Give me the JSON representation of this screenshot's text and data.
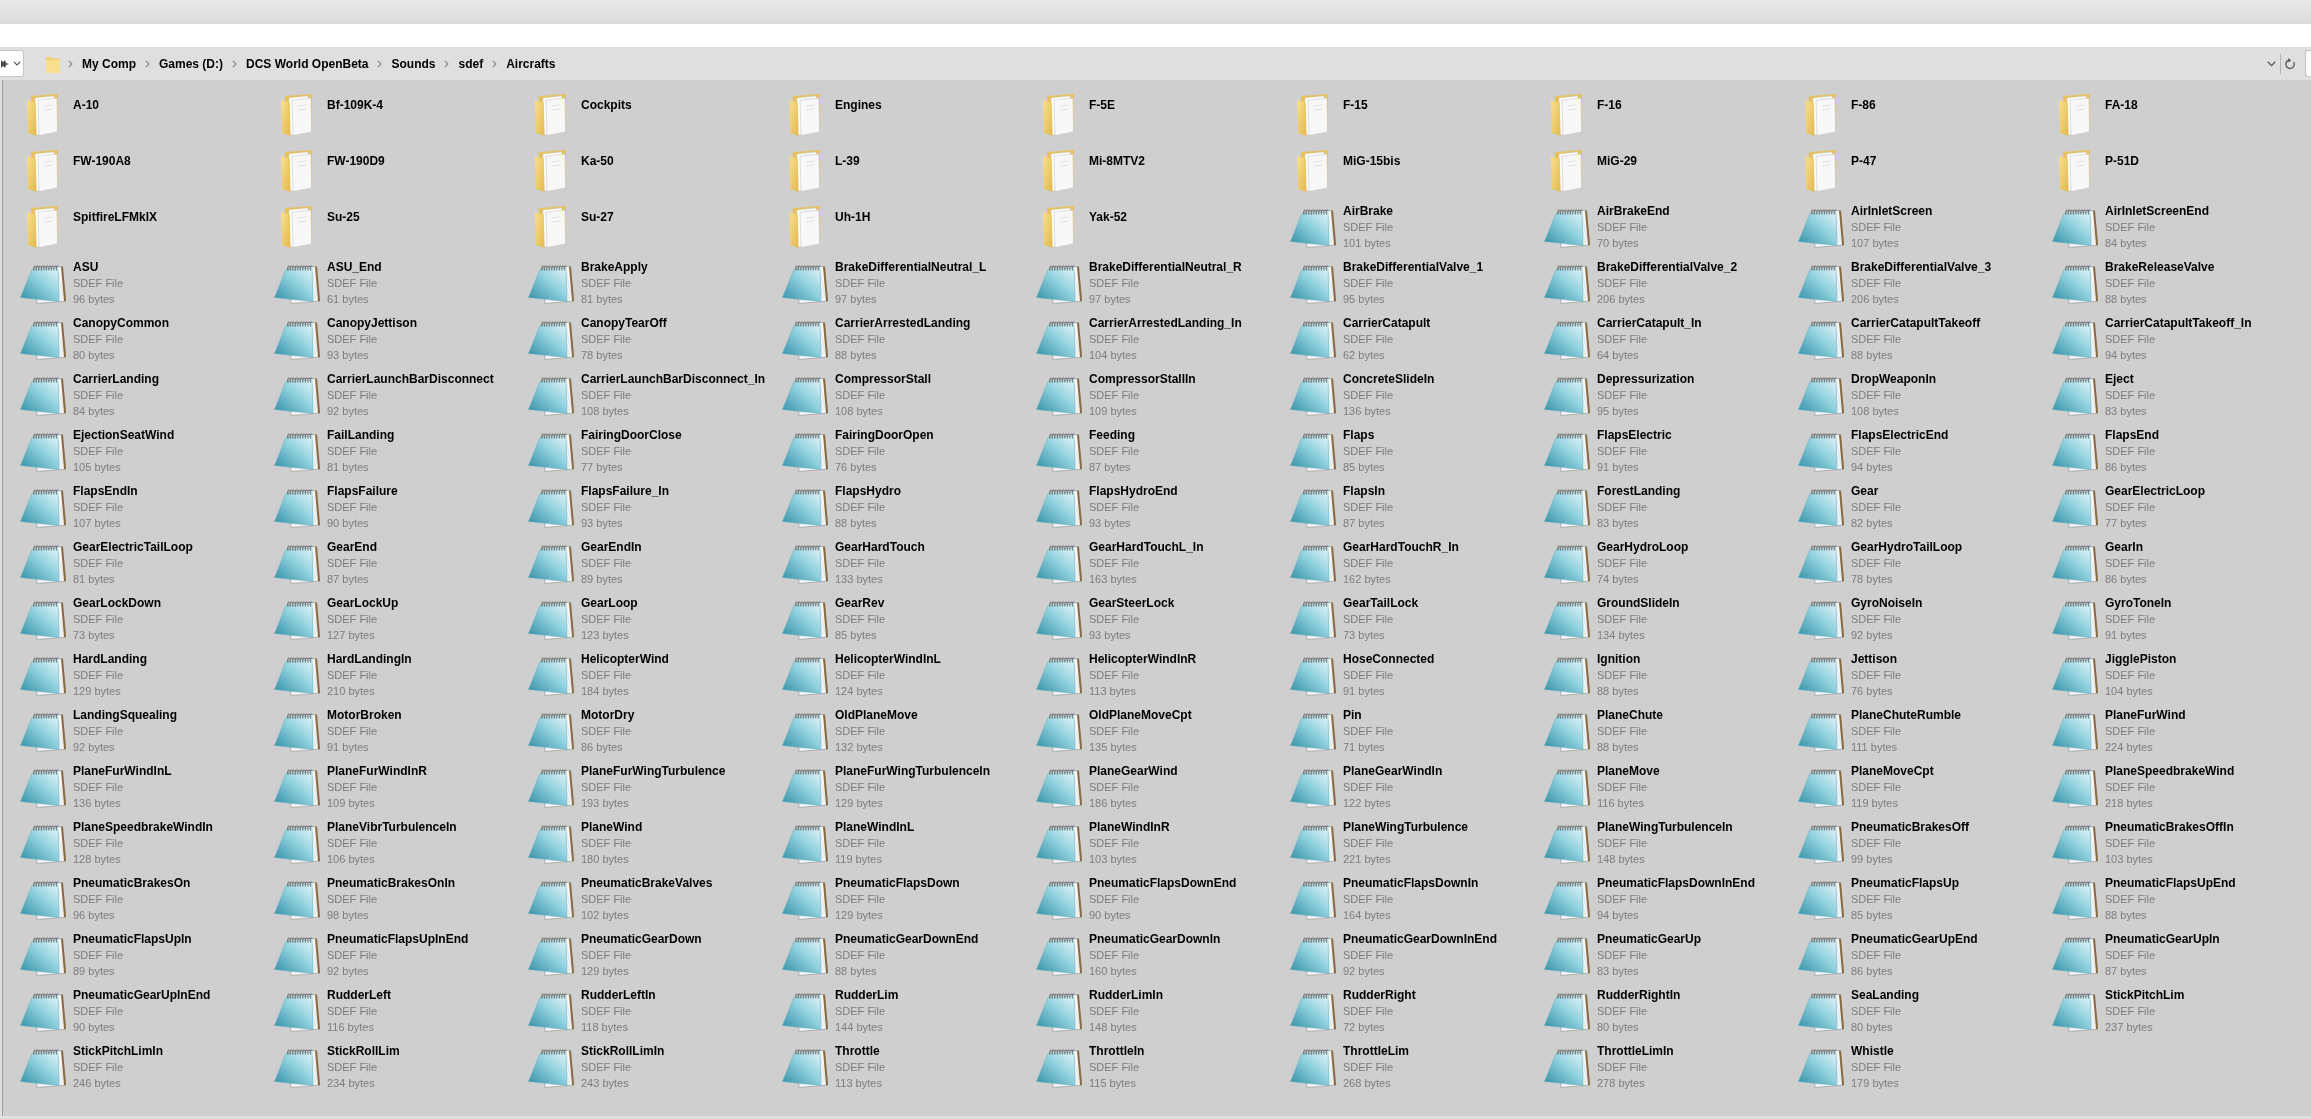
{
  "address_bar": {
    "path": [
      "My Comp",
      "Games (D:)",
      "DCS World OpenBeta",
      "Sounds",
      "sdef",
      "Aircrafts"
    ]
  },
  "items": [
    {
      "kind": "folder",
      "name": "A-10"
    },
    {
      "kind": "folder",
      "name": "Bf-109K-4"
    },
    {
      "kind": "folder",
      "name": "Cockpits"
    },
    {
      "kind": "folder",
      "name": "Engines"
    },
    {
      "kind": "folder",
      "name": "F-5E"
    },
    {
      "kind": "folder",
      "name": "F-15"
    },
    {
      "kind": "folder",
      "name": "F-16"
    },
    {
      "kind": "folder",
      "name": "F-86"
    },
    {
      "kind": "folder",
      "name": "FA-18"
    },
    {
      "kind": "folder",
      "name": "FW-190A8"
    },
    {
      "kind": "folder",
      "name": "FW-190D9"
    },
    {
      "kind": "folder",
      "name": "Ka-50"
    },
    {
      "kind": "folder",
      "name": "L-39"
    },
    {
      "kind": "folder",
      "name": "Mi-8MTV2"
    },
    {
      "kind": "folder",
      "name": "MiG-15bis"
    },
    {
      "kind": "folder",
      "name": "MiG-29"
    },
    {
      "kind": "folder",
      "name": "P-47"
    },
    {
      "kind": "folder",
      "name": "P-51D"
    },
    {
      "kind": "folder",
      "name": "SpitfireLFMkIX"
    },
    {
      "kind": "folder",
      "name": "Su-25"
    },
    {
      "kind": "folder",
      "name": "Su-27"
    },
    {
      "kind": "folder",
      "name": "Uh-1H"
    },
    {
      "kind": "folder",
      "name": "Yak-52"
    },
    {
      "kind": "file",
      "name": "AirBrake",
      "type": "SDEF File",
      "size": "101 bytes"
    },
    {
      "kind": "file",
      "name": "AirBrakeEnd",
      "type": "SDEF File",
      "size": "70 bytes"
    },
    {
      "kind": "file",
      "name": "AirInletScreen",
      "type": "SDEF File",
      "size": "107 bytes"
    },
    {
      "kind": "file",
      "name": "AirInletScreenEnd",
      "type": "SDEF File",
      "size": "84 bytes"
    },
    {
      "kind": "file",
      "name": "ASU",
      "type": "SDEF File",
      "size": "96 bytes"
    },
    {
      "kind": "file",
      "name": "ASU_End",
      "type": "SDEF File",
      "size": "61 bytes"
    },
    {
      "kind": "file",
      "name": "BrakeApply",
      "type": "SDEF File",
      "size": "81 bytes"
    },
    {
      "kind": "file",
      "name": "BrakeDifferentialNeutral_L",
      "type": "SDEF File",
      "size": "97 bytes"
    },
    {
      "kind": "file",
      "name": "BrakeDifferentialNeutral_R",
      "type": "SDEF File",
      "size": "97 bytes"
    },
    {
      "kind": "file",
      "name": "BrakeDifferentialValve_1",
      "type": "SDEF File",
      "size": "95 bytes"
    },
    {
      "kind": "file",
      "name": "BrakeDifferentialValve_2",
      "type": "SDEF File",
      "size": "206 bytes"
    },
    {
      "kind": "file",
      "name": "BrakeDifferentialValve_3",
      "type": "SDEF File",
      "size": "206 bytes"
    },
    {
      "kind": "file",
      "name": "BrakeReleaseValve",
      "type": "SDEF File",
      "size": "88 bytes"
    },
    {
      "kind": "file",
      "name": "CanopyCommon",
      "type": "SDEF File",
      "size": "80 bytes"
    },
    {
      "kind": "file",
      "name": "CanopyJettison",
      "type": "SDEF File",
      "size": "93 bytes"
    },
    {
      "kind": "file",
      "name": "CanopyTearOff",
      "type": "SDEF File",
      "size": "78 bytes"
    },
    {
      "kind": "file",
      "name": "CarrierArrestedLanding",
      "type": "SDEF File",
      "size": "88 bytes"
    },
    {
      "kind": "file",
      "name": "CarrierArrestedLanding_In",
      "type": "SDEF File",
      "size": "104 bytes"
    },
    {
      "kind": "file",
      "name": "CarrierCatapult",
      "type": "SDEF File",
      "size": "62 bytes"
    },
    {
      "kind": "file",
      "name": "CarrierCatapult_In",
      "type": "SDEF File",
      "size": "64 bytes"
    },
    {
      "kind": "file",
      "name": "CarrierCatapultTakeoff",
      "type": "SDEF File",
      "size": "88 bytes"
    },
    {
      "kind": "file",
      "name": "CarrierCatapultTakeoff_In",
      "type": "SDEF File",
      "size": "94 bytes"
    },
    {
      "kind": "file",
      "name": "CarrierLanding",
      "type": "SDEF File",
      "size": "84 bytes"
    },
    {
      "kind": "file",
      "name": "CarrierLaunchBarDisconnect",
      "type": "SDEF File",
      "size": "92 bytes"
    },
    {
      "kind": "file",
      "name": "CarrierLaunchBarDisconnect_In",
      "type": "SDEF File",
      "size": "108 bytes"
    },
    {
      "kind": "file",
      "name": "CompressorStall",
      "type": "SDEF File",
      "size": "108 bytes"
    },
    {
      "kind": "file",
      "name": "CompressorStallIn",
      "type": "SDEF File",
      "size": "109 bytes"
    },
    {
      "kind": "file",
      "name": "ConcreteSlideIn",
      "type": "SDEF File",
      "size": "136 bytes"
    },
    {
      "kind": "file",
      "name": "Depressurization",
      "type": "SDEF File",
      "size": "95 bytes"
    },
    {
      "kind": "file",
      "name": "DropWeaponIn",
      "type": "SDEF File",
      "size": "108 bytes"
    },
    {
      "kind": "file",
      "name": "Eject",
      "type": "SDEF File",
      "size": "83 bytes"
    },
    {
      "kind": "file",
      "name": "EjectionSeatWind",
      "type": "SDEF File",
      "size": "105 bytes"
    },
    {
      "kind": "file",
      "name": "FailLanding",
      "type": "SDEF File",
      "size": "81 bytes"
    },
    {
      "kind": "file",
      "name": "FairingDoorClose",
      "type": "SDEF File",
      "size": "77 bytes"
    },
    {
      "kind": "file",
      "name": "FairingDoorOpen",
      "type": "SDEF File",
      "size": "76 bytes"
    },
    {
      "kind": "file",
      "name": "Feeding",
      "type": "SDEF File",
      "size": "87 bytes"
    },
    {
      "kind": "file",
      "name": "Flaps",
      "type": "SDEF File",
      "size": "85 bytes"
    },
    {
      "kind": "file",
      "name": "FlapsElectric",
      "type": "SDEF File",
      "size": "91 bytes"
    },
    {
      "kind": "file",
      "name": "FlapsElectricEnd",
      "type": "SDEF File",
      "size": "94 bytes"
    },
    {
      "kind": "file",
      "name": "FlapsEnd",
      "type": "SDEF File",
      "size": "86 bytes"
    },
    {
      "kind": "file",
      "name": "FlapsEndIn",
      "type": "SDEF File",
      "size": "107 bytes"
    },
    {
      "kind": "file",
      "name": "FlapsFailure",
      "type": "SDEF File",
      "size": "90 bytes"
    },
    {
      "kind": "file",
      "name": "FlapsFailure_In",
      "type": "SDEF File",
      "size": "93 bytes"
    },
    {
      "kind": "file",
      "name": "FlapsHydro",
      "type": "SDEF File",
      "size": "88 bytes"
    },
    {
      "kind": "file",
      "name": "FlapsHydroEnd",
      "type": "SDEF File",
      "size": "93 bytes"
    },
    {
      "kind": "file",
      "name": "FlapsIn",
      "type": "SDEF File",
      "size": "87 bytes"
    },
    {
      "kind": "file",
      "name": "ForestLanding",
      "type": "SDEF File",
      "size": "83 bytes"
    },
    {
      "kind": "file",
      "name": "Gear",
      "type": "SDEF File",
      "size": "82 bytes"
    },
    {
      "kind": "file",
      "name": "GearElectricLoop",
      "type": "SDEF File",
      "size": "77 bytes"
    },
    {
      "kind": "file",
      "name": "GearElectricTailLoop",
      "type": "SDEF File",
      "size": "81 bytes"
    },
    {
      "kind": "file",
      "name": "GearEnd",
      "type": "SDEF File",
      "size": "87 bytes"
    },
    {
      "kind": "file",
      "name": "GearEndIn",
      "type": "SDEF File",
      "size": "89 bytes"
    },
    {
      "kind": "file",
      "name": "GearHardTouch",
      "type": "SDEF File",
      "size": "133 bytes"
    },
    {
      "kind": "file",
      "name": "GearHardTouchL_In",
      "type": "SDEF File",
      "size": "163 bytes"
    },
    {
      "kind": "file",
      "name": "GearHardTouchR_In",
      "type": "SDEF File",
      "size": "162 bytes"
    },
    {
      "kind": "file",
      "name": "GearHydroLoop",
      "type": "SDEF File",
      "size": "74 bytes"
    },
    {
      "kind": "file",
      "name": "GearHydroTailLoop",
      "type": "SDEF File",
      "size": "78 bytes"
    },
    {
      "kind": "file",
      "name": "GearIn",
      "type": "SDEF File",
      "size": "86 bytes"
    },
    {
      "kind": "file",
      "name": "GearLockDown",
      "type": "SDEF File",
      "size": "73 bytes"
    },
    {
      "kind": "file",
      "name": "GearLockUp",
      "type": "SDEF File",
      "size": "127 bytes"
    },
    {
      "kind": "file",
      "name": "GearLoop",
      "type": "SDEF File",
      "size": "123 bytes"
    },
    {
      "kind": "file",
      "name": "GearRev",
      "type": "SDEF File",
      "size": "85 bytes"
    },
    {
      "kind": "file",
      "name": "GearSteerLock",
      "type": "SDEF File",
      "size": "93 bytes"
    },
    {
      "kind": "file",
      "name": "GearTailLock",
      "type": "SDEF File",
      "size": "73 bytes"
    },
    {
      "kind": "file",
      "name": "GroundSlideIn",
      "type": "SDEF File",
      "size": "134 bytes"
    },
    {
      "kind": "file",
      "name": "GyroNoiseIn",
      "type": "SDEF File",
      "size": "92 bytes"
    },
    {
      "kind": "file",
      "name": "GyroToneIn",
      "type": "SDEF File",
      "size": "91 bytes"
    },
    {
      "kind": "file",
      "name": "HardLanding",
      "type": "SDEF File",
      "size": "129 bytes"
    },
    {
      "kind": "file",
      "name": "HardLandingIn",
      "type": "SDEF File",
      "size": "210 bytes"
    },
    {
      "kind": "file",
      "name": "HelicopterWind",
      "type": "SDEF File",
      "size": "184 bytes"
    },
    {
      "kind": "file",
      "name": "HelicopterWindInL",
      "type": "SDEF File",
      "size": "124 bytes"
    },
    {
      "kind": "file",
      "name": "HelicopterWindInR",
      "type": "SDEF File",
      "size": "113 bytes"
    },
    {
      "kind": "file",
      "name": "HoseConnected",
      "type": "SDEF File",
      "size": "91 bytes"
    },
    {
      "kind": "file",
      "name": "Ignition",
      "type": "SDEF File",
      "size": "88 bytes"
    },
    {
      "kind": "file",
      "name": "Jettison",
      "type": "SDEF File",
      "size": "76 bytes"
    },
    {
      "kind": "file",
      "name": "JigglePiston",
      "type": "SDEF File",
      "size": "104 bytes"
    },
    {
      "kind": "file",
      "name": "LandingSquealing",
      "type": "SDEF File",
      "size": "92 bytes"
    },
    {
      "kind": "file",
      "name": "MotorBroken",
      "type": "SDEF File",
      "size": "91 bytes"
    },
    {
      "kind": "file",
      "name": "MotorDry",
      "type": "SDEF File",
      "size": "86 bytes"
    },
    {
      "kind": "file",
      "name": "OldPlaneMove",
      "type": "SDEF File",
      "size": "132 bytes"
    },
    {
      "kind": "file",
      "name": "OldPlaneMoveCpt",
      "type": "SDEF File",
      "size": "135 bytes"
    },
    {
      "kind": "file",
      "name": "Pin",
      "type": "SDEF File",
      "size": "71 bytes"
    },
    {
      "kind": "file",
      "name": "PlaneChute",
      "type": "SDEF File",
      "size": "88 bytes"
    },
    {
      "kind": "file",
      "name": "PlaneChuteRumble",
      "type": "SDEF File",
      "size": "111 bytes"
    },
    {
      "kind": "file",
      "name": "PlaneFurWind",
      "type": "SDEF File",
      "size": "224 bytes"
    },
    {
      "kind": "file",
      "name": "PlaneFurWindInL",
      "type": "SDEF File",
      "size": "136 bytes"
    },
    {
      "kind": "file",
      "name": "PlaneFurWindInR",
      "type": "SDEF File",
      "size": "109 bytes"
    },
    {
      "kind": "file",
      "name": "PlaneFurWingTurbulence",
      "type": "SDEF File",
      "size": "193 bytes"
    },
    {
      "kind": "file",
      "name": "PlaneFurWingTurbulenceIn",
      "type": "SDEF File",
      "size": "129 bytes"
    },
    {
      "kind": "file",
      "name": "PlaneGearWind",
      "type": "SDEF File",
      "size": "186 bytes"
    },
    {
      "kind": "file",
      "name": "PlaneGearWindIn",
      "type": "SDEF File",
      "size": "122 bytes"
    },
    {
      "kind": "file",
      "name": "PlaneMove",
      "type": "SDEF File",
      "size": "116 bytes"
    },
    {
      "kind": "file",
      "name": "PlaneMoveCpt",
      "type": "SDEF File",
      "size": "119 bytes"
    },
    {
      "kind": "file",
      "name": "PlaneSpeedbrakeWind",
      "type": "SDEF File",
      "size": "218 bytes"
    },
    {
      "kind": "file",
      "name": "PlaneSpeedbrakeWindIn",
      "type": "SDEF File",
      "size": "128 bytes"
    },
    {
      "kind": "file",
      "name": "PlaneVibrTurbulenceIn",
      "type": "SDEF File",
      "size": "106 bytes"
    },
    {
      "kind": "file",
      "name": "PlaneWind",
      "type": "SDEF File",
      "size": "180 bytes"
    },
    {
      "kind": "file",
      "name": "PlaneWindInL",
      "type": "SDEF File",
      "size": "119 bytes"
    },
    {
      "kind": "file",
      "name": "PlaneWindInR",
      "type": "SDEF File",
      "size": "103 bytes"
    },
    {
      "kind": "file",
      "name": "PlaneWingTurbulence",
      "type": "SDEF File",
      "size": "221 bytes"
    },
    {
      "kind": "file",
      "name": "PlaneWingTurbulenceIn",
      "type": "SDEF File",
      "size": "148 bytes"
    },
    {
      "kind": "file",
      "name": "PneumaticBrakesOff",
      "type": "SDEF File",
      "size": "99 bytes"
    },
    {
      "kind": "file",
      "name": "PneumaticBrakesOffIn",
      "type": "SDEF File",
      "size": "103 bytes"
    },
    {
      "kind": "file",
      "name": "PneumaticBrakesOn",
      "type": "SDEF File",
      "size": "96 bytes"
    },
    {
      "kind": "file",
      "name": "PneumaticBrakesOnIn",
      "type": "SDEF File",
      "size": "98 bytes"
    },
    {
      "kind": "file",
      "name": "PneumaticBrakeValves",
      "type": "SDEF File",
      "size": "102 bytes"
    },
    {
      "kind": "file",
      "name": "PneumaticFlapsDown",
      "type": "SDEF File",
      "size": "129 bytes"
    },
    {
      "kind": "file",
      "name": "PneumaticFlapsDownEnd",
      "type": "SDEF File",
      "size": "90 bytes"
    },
    {
      "kind": "file",
      "name": "PneumaticFlapsDownIn",
      "type": "SDEF File",
      "size": "164 bytes"
    },
    {
      "kind": "file",
      "name": "PneumaticFlapsDownInEnd",
      "type": "SDEF File",
      "size": "94 bytes"
    },
    {
      "kind": "file",
      "name": "PneumaticFlapsUp",
      "type": "SDEF File",
      "size": "85 bytes"
    },
    {
      "kind": "file",
      "name": "PneumaticFlapsUpEnd",
      "type": "SDEF File",
      "size": "88 bytes"
    },
    {
      "kind": "file",
      "name": "PneumaticFlapsUpIn",
      "type": "SDEF File",
      "size": "89 bytes"
    },
    {
      "kind": "file",
      "name": "PneumaticFlapsUpInEnd",
      "type": "SDEF File",
      "size": "92 bytes"
    },
    {
      "kind": "file",
      "name": "PneumaticGearDown",
      "type": "SDEF File",
      "size": "129 bytes"
    },
    {
      "kind": "file",
      "name": "PneumaticGearDownEnd",
      "type": "SDEF File",
      "size": "88 bytes"
    },
    {
      "kind": "file",
      "name": "PneumaticGearDownIn",
      "type": "SDEF File",
      "size": "160 bytes"
    },
    {
      "kind": "file",
      "name": "PneumaticGearDownInEnd",
      "type": "SDEF File",
      "size": "92 bytes"
    },
    {
      "kind": "file",
      "name": "PneumaticGearUp",
      "type": "SDEF File",
      "size": "83 bytes"
    },
    {
      "kind": "file",
      "name": "PneumaticGearUpEnd",
      "type": "SDEF File",
      "size": "86 bytes"
    },
    {
      "kind": "file",
      "name": "PneumaticGearUpIn",
      "type": "SDEF File",
      "size": "87 bytes"
    },
    {
      "kind": "file",
      "name": "PneumaticGearUpInEnd",
      "type": "SDEF File",
      "size": "90 bytes"
    },
    {
      "kind": "file",
      "name": "RudderLeft",
      "type": "SDEF File",
      "size": "116 bytes"
    },
    {
      "kind": "file",
      "name": "RudderLeftIn",
      "type": "SDEF File",
      "size": "118 bytes"
    },
    {
      "kind": "file",
      "name": "RudderLim",
      "type": "SDEF File",
      "size": "144 bytes"
    },
    {
      "kind": "file",
      "name": "RudderLimIn",
      "type": "SDEF File",
      "size": "148 bytes"
    },
    {
      "kind": "file",
      "name": "RudderRight",
      "type": "SDEF File",
      "size": "72 bytes"
    },
    {
      "kind": "file",
      "name": "RudderRightIn",
      "type": "SDEF File",
      "size": "80 bytes"
    },
    {
      "kind": "file",
      "name": "SeaLanding",
      "type": "SDEF File",
      "size": "80 bytes"
    },
    {
      "kind": "file",
      "name": "StickPitchLim",
      "type": "SDEF File",
      "size": "237 bytes"
    },
    {
      "kind": "file",
      "name": "StickPitchLimIn",
      "type": "SDEF File",
      "size": "246 bytes"
    },
    {
      "kind": "file",
      "name": "StickRollLim",
      "type": "SDEF File",
      "size": "234 bytes"
    },
    {
      "kind": "file",
      "name": "StickRollLimIn",
      "type": "SDEF File",
      "size": "243 bytes"
    },
    {
      "kind": "file",
      "name": "Throttle",
      "type": "SDEF File",
      "size": "113 bytes"
    },
    {
      "kind": "file",
      "name": "ThrottleIn",
      "type": "SDEF File",
      "size": "115 bytes"
    },
    {
      "kind": "file",
      "name": "ThrottleLim",
      "type": "SDEF File",
      "size": "268 bytes"
    },
    {
      "kind": "file",
      "name": "ThrottleLimIn",
      "type": "SDEF File",
      "size": "278 bytes"
    },
    {
      "kind": "file",
      "name": "Whistle",
      "type": "SDEF File",
      "size": "179 bytes"
    }
  ]
}
